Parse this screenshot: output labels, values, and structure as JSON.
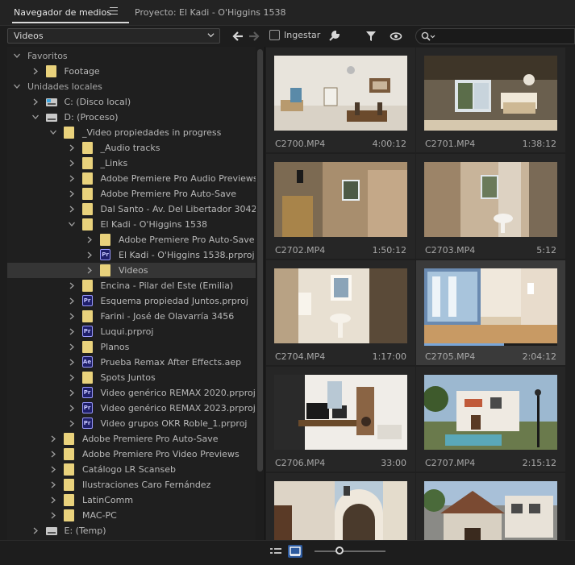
{
  "tabs": {
    "active_label": "Navegador de medios",
    "project_label": "Proyecto: El Kadi - O'Higgins 1538"
  },
  "toolbar": {
    "view_select_value": "Videos",
    "ingest_label": "Ingestar",
    "ingest_checked": false,
    "search_placeholder": ""
  },
  "tree": [
    {
      "label": "Favoritos",
      "depth": 0,
      "kind": "section",
      "expanded": true
    },
    {
      "label": "Footage",
      "depth": 1,
      "kind": "folder",
      "expanded": false
    },
    {
      "label": "Unidades locales",
      "depth": 0,
      "kind": "section",
      "expanded": true
    },
    {
      "label": "C: (Disco local)",
      "depth": 1,
      "kind": "drive-win",
      "expanded": false
    },
    {
      "label": "D: (Proceso)",
      "depth": 1,
      "kind": "drive",
      "expanded": true
    },
    {
      "label": "_Video propiedades in progress",
      "depth": 2,
      "kind": "folder",
      "expanded": true
    },
    {
      "label": "_Audio tracks",
      "depth": 3,
      "kind": "folder",
      "expanded": false
    },
    {
      "label": "_Links",
      "depth": 3,
      "kind": "folder",
      "expanded": false
    },
    {
      "label": "Adobe Premiere Pro Audio Previews",
      "depth": 3,
      "kind": "folder",
      "expanded": false
    },
    {
      "label": "Adobe Premiere Pro Auto-Save",
      "depth": 3,
      "kind": "folder",
      "expanded": false
    },
    {
      "label": "Dal Santo - Av. Del Libertador 3042",
      "depth": 3,
      "kind": "folder",
      "expanded": false
    },
    {
      "label": "El Kadi - O'Higgins 1538",
      "depth": 3,
      "kind": "folder",
      "expanded": true
    },
    {
      "label": "Adobe Premiere Pro Auto-Save",
      "depth": 4,
      "kind": "folder",
      "expanded": false
    },
    {
      "label": "El Kadi - O'Higgins 1538.prproj",
      "depth": 4,
      "kind": "prproj",
      "expanded": false
    },
    {
      "label": "Videos",
      "depth": 4,
      "kind": "folder",
      "expanded": false,
      "selected": true
    },
    {
      "label": "Encina - Pilar del Este (Emilia)",
      "depth": 3,
      "kind": "folder",
      "expanded": false
    },
    {
      "label": "Esquema propiedad Juntos.prproj",
      "depth": 3,
      "kind": "prproj",
      "expanded": false
    },
    {
      "label": "Farini - José de Olavarría 3456",
      "depth": 3,
      "kind": "folder",
      "expanded": false
    },
    {
      "label": "Luqui.prproj",
      "depth": 3,
      "kind": "prproj",
      "expanded": false
    },
    {
      "label": "Planos",
      "depth": 3,
      "kind": "folder",
      "expanded": false
    },
    {
      "label": "Prueba Remax After Effects.aep",
      "depth": 3,
      "kind": "aep",
      "expanded": false
    },
    {
      "label": "Spots Juntos",
      "depth": 3,
      "kind": "folder",
      "expanded": false
    },
    {
      "label": "Video genérico REMAX 2020.prproj",
      "depth": 3,
      "kind": "prproj",
      "expanded": false
    },
    {
      "label": "Video genérico REMAX 2023.prproj",
      "depth": 3,
      "kind": "prproj",
      "expanded": false
    },
    {
      "label": "Video grupos OKR Roble_1.prproj",
      "depth": 3,
      "kind": "prproj",
      "expanded": false
    },
    {
      "label": "Adobe Premiere Pro Auto-Save",
      "depth": 2,
      "kind": "folder",
      "expanded": false
    },
    {
      "label": "Adobe Premiere Pro Video Previews",
      "depth": 2,
      "kind": "folder",
      "expanded": false
    },
    {
      "label": "Catálogo LR Scanseb",
      "depth": 2,
      "kind": "folder",
      "expanded": false
    },
    {
      "label": "Ilustraciones Caro Fernández",
      "depth": 2,
      "kind": "folder",
      "expanded": false
    },
    {
      "label": "LatinComm",
      "depth": 2,
      "kind": "folder",
      "expanded": false
    },
    {
      "label": "MAC-PC",
      "depth": 2,
      "kind": "folder",
      "expanded": false
    },
    {
      "label": "E: (Temp)",
      "depth": 1,
      "kind": "drive",
      "expanded": false
    }
  ],
  "clips": [
    {
      "name": "C2700.MP4",
      "duration": "4:00:12",
      "scene": "dining"
    },
    {
      "name": "C2701.MP4",
      "duration": "1:38:12",
      "scene": "bedroom-window"
    },
    {
      "name": "C2702.MP4",
      "duration": "1:50:12",
      "scene": "hallway"
    },
    {
      "name": "C2703.MP4",
      "duration": "5:12",
      "scene": "bathroom-window"
    },
    {
      "name": "C2704.MP4",
      "duration": "1:17:00",
      "scene": "bathroom-sink"
    },
    {
      "name": "C2705.MP4",
      "duration": "2:04:12",
      "scene": "bathroom-bright",
      "selected": true,
      "progress": 0.6
    },
    {
      "name": "C2706.MP4",
      "duration": "33:00",
      "scene": "office"
    },
    {
      "name": "C2707.MP4",
      "duration": "2:15:12",
      "scene": "house-pool"
    },
    {
      "name": "",
      "duration": "",
      "scene": "facade-arch"
    },
    {
      "name": "",
      "duration": "",
      "scene": "street-house"
    }
  ],
  "bottom": {
    "zoom_level": 0.35
  }
}
